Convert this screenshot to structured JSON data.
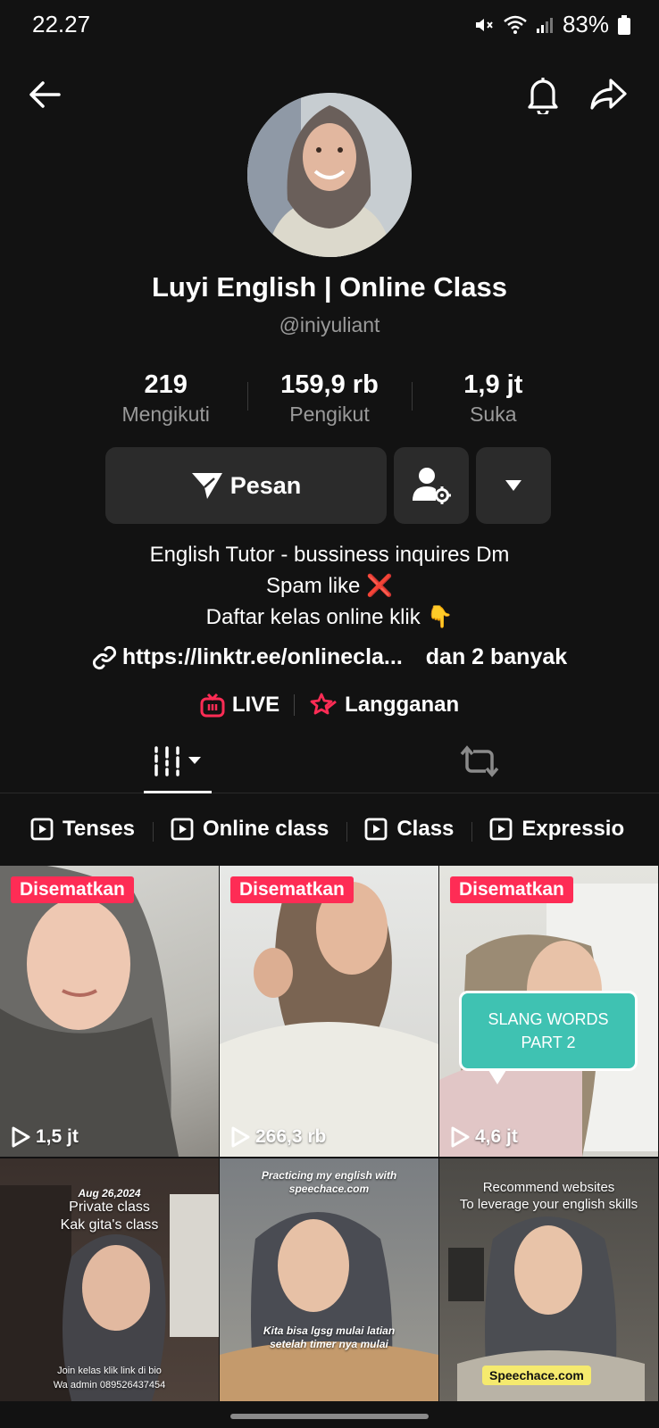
{
  "status": {
    "time": "22.27",
    "battery": "83%"
  },
  "profile": {
    "name": "Luyi English | Online Class",
    "handle": "@iniyuliant",
    "stats": [
      {
        "value": "219",
        "label": "Mengikuti"
      },
      {
        "value": "159,9 rb",
        "label": "Pengikut"
      },
      {
        "value": "1,9 jt",
        "label": "Suka"
      }
    ],
    "message_label": "Pesan",
    "bio": [
      "English Tutor - bussiness inquires Dm",
      "Spam like",
      "Daftar kelas online klik"
    ],
    "bio_emojis": [
      "❌",
      "👇"
    ],
    "link": "https://linktr.ee/onlinecla...",
    "link_extra": "dan 2 banyak",
    "live_label": "LIVE",
    "subscription_label": "Langganan"
  },
  "playlists": [
    "Tenses",
    "Online class",
    "Class",
    "Expressio"
  ],
  "videos": [
    {
      "pinned": "Disematkan",
      "views": "1,5 jt"
    },
    {
      "pinned": "Disematkan",
      "views": "266,3 rb"
    },
    {
      "pinned": "Disematkan",
      "views": "4,6 jt",
      "bubble": "SLANG WORDS PART 2"
    },
    {
      "date": "Aug 26,2024",
      "caption_top": "Private class",
      "caption_top2": "Kak gita's class",
      "caption_bottom": "Join kelas klik link di bio",
      "caption_bottom2": "Wa admin 089526437454"
    },
    {
      "caption_top": "Practicing my english with",
      "caption_top2": "speechace.com",
      "caption_bottom": "Kita bisa lgsg mulai latian",
      "caption_bottom2": "setelah timer nya mulai"
    },
    {
      "caption_top": "Recommend websites",
      "caption_top2": "To leverage your english skills",
      "label": "Speechace.com"
    }
  ],
  "colors": {
    "background": "#121212",
    "pinned": "#fe2c55",
    "button": "#2b2b2b",
    "live": "#fe2c55"
  }
}
